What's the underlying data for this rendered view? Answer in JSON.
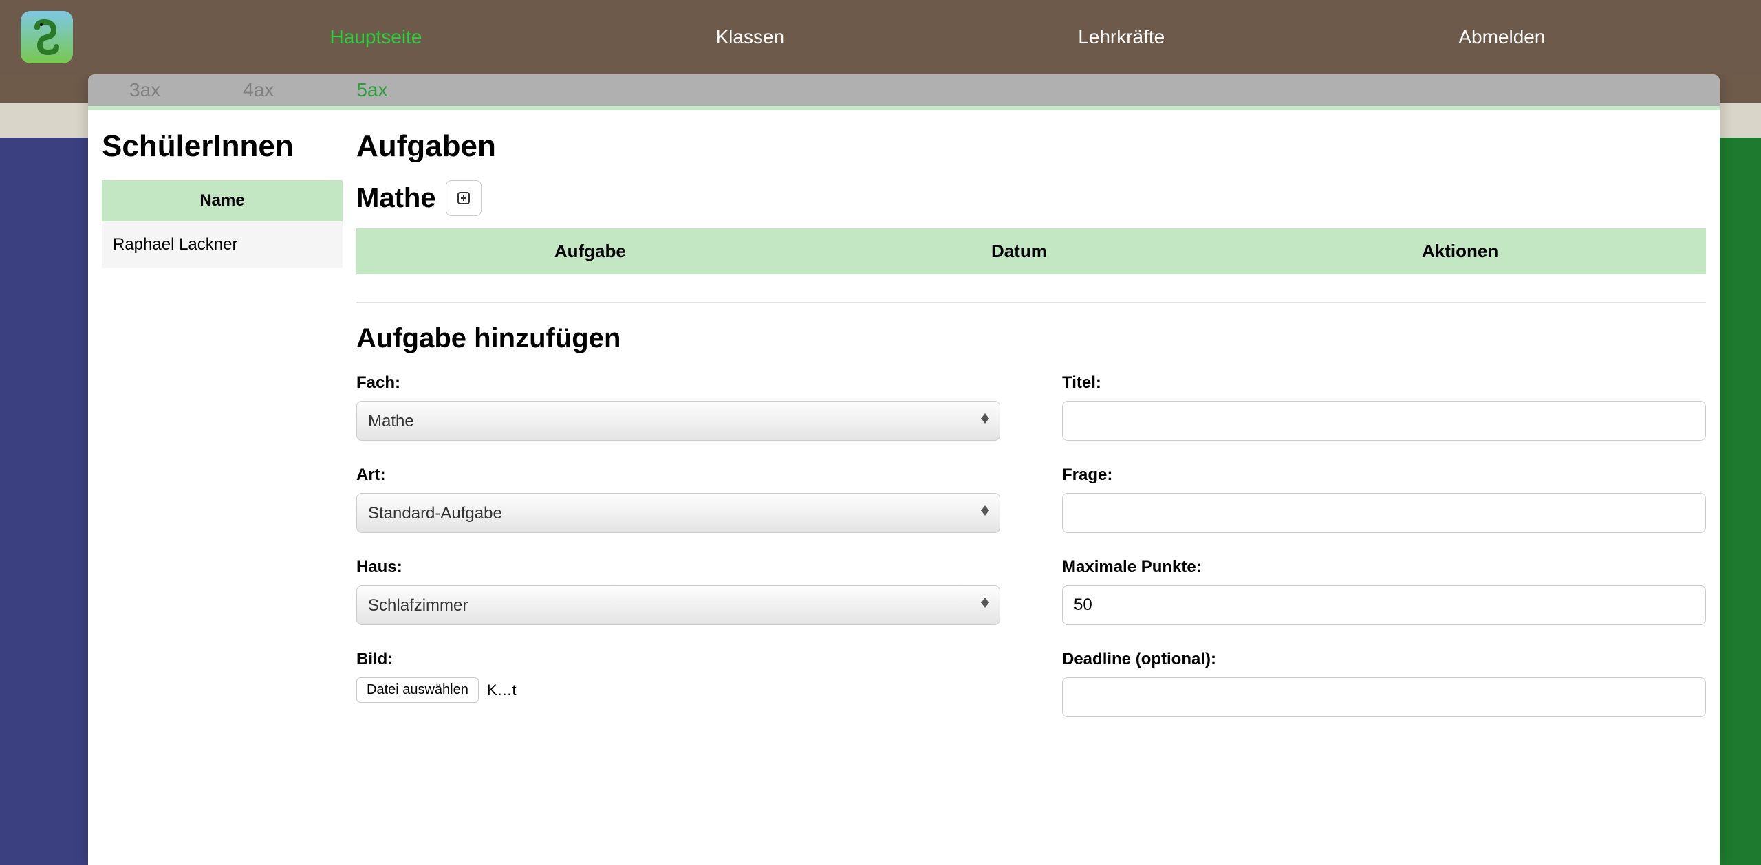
{
  "nav": {
    "items": [
      {
        "label": "Hauptseite",
        "active": true
      },
      {
        "label": "Klassen",
        "active": false
      },
      {
        "label": "Lehrkräfte",
        "active": false
      },
      {
        "label": "Abmelden",
        "active": false
      }
    ]
  },
  "tabs": [
    {
      "label": "3ax",
      "active": false
    },
    {
      "label": "4ax",
      "active": false
    },
    {
      "label": "5ax",
      "active": true
    }
  ],
  "students": {
    "title": "SchülerInnen",
    "header": "Name",
    "rows": [
      "Raphael Lackner"
    ]
  },
  "tasks": {
    "title": "Aufgaben",
    "subject": "Mathe",
    "columns": [
      "Aufgabe",
      "Datum",
      "Aktionen"
    ]
  },
  "form": {
    "title": "Aufgabe hinzufügen",
    "fields": {
      "subject": {
        "label": "Fach:",
        "value": "Mathe"
      },
      "title": {
        "label": "Titel:",
        "value": ""
      },
      "type": {
        "label": "Art:",
        "value": "Standard-Aufgabe"
      },
      "question": {
        "label": "Frage:",
        "value": ""
      },
      "house": {
        "label": "Haus:",
        "value": "Schlafzimmer"
      },
      "maxpoints": {
        "label": "Maximale Punkte:",
        "value": "50"
      },
      "image": {
        "label": "Bild:",
        "button": "Datei auswählen",
        "filename": "K…t"
      },
      "deadline": {
        "label": "Deadline (optional):",
        "value": ""
      }
    }
  }
}
